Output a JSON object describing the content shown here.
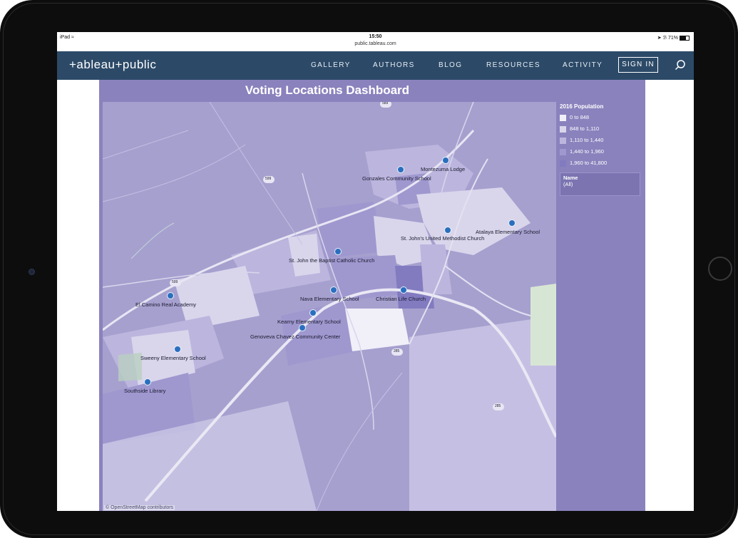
{
  "status_bar": {
    "device": "iPad",
    "wifi_icon": "wifi-icon",
    "time": "15:50",
    "url": "public.tableau.com",
    "battery": "71%"
  },
  "nav": {
    "logo": "+ableau+public",
    "items": [
      "GALLERY",
      "AUTHORS",
      "BLOG",
      "RESOURCES",
      "ACTIVITY"
    ],
    "signin": "SIGN IN",
    "search_icon": "search-icon"
  },
  "dashboard": {
    "title": "Voting Locations Dashboard",
    "map_attribution": "© OpenStreetMap contributors",
    "locations": [
      {
        "name": "Montezuma Lodge"
      },
      {
        "name": "Gonzales Community School"
      },
      {
        "name": "Atalaya Elementary School"
      },
      {
        "name": "St. John's United Methodist Church"
      },
      {
        "name": "St. John the Baptist Catholic Church"
      },
      {
        "name": "El Camino Real Academy"
      },
      {
        "name": "Nava Elementary School"
      },
      {
        "name": "Christian Life Church"
      },
      {
        "name": "Kearny Elementary School"
      },
      {
        "name": "Genoveva Chavez Community Center"
      },
      {
        "name": "Sweeny Elementary School"
      },
      {
        "name": "Southside Library"
      }
    ],
    "road_shields": [
      "599",
      "589",
      "599",
      "285",
      "285"
    ],
    "legend": {
      "title": "2016 Population",
      "items": [
        {
          "label": "0 to 848",
          "color": "#f1eff8"
        },
        {
          "label": "848 to 1,110",
          "color": "#d9d6ec"
        },
        {
          "label": "1,110 to 1,440",
          "color": "#bcb6de"
        },
        {
          "label": "1,440 to 1,960",
          "color": "#9f98cf"
        },
        {
          "label": "1,960 to 41,800",
          "color": "#827bc0"
        }
      ]
    },
    "name_filter": {
      "title": "Name",
      "value": "(All)"
    }
  }
}
